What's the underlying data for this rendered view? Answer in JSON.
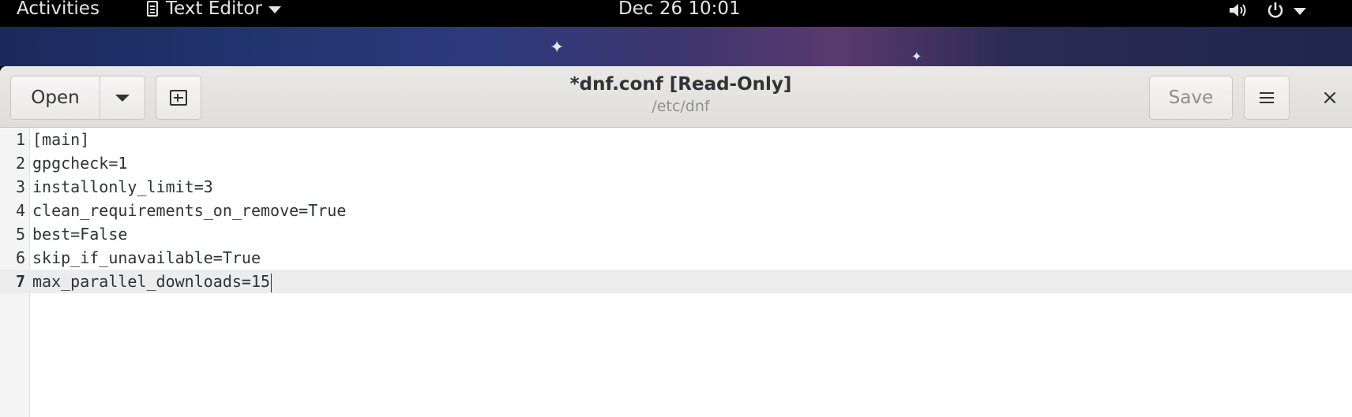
{
  "topbar": {
    "activities_label": "Activities",
    "app_name": "Text Editor",
    "clock": "Dec 26  10:01",
    "icons": [
      "text-editor-icon",
      "volume-icon",
      "power-icon",
      "chevron-down-icon"
    ]
  },
  "window": {
    "title": "*dnf.conf [Read-Only]",
    "subtitle": "/etc/dnf",
    "open_label": "Open",
    "save_label": "Save",
    "close_glyph": "×"
  },
  "editor": {
    "current_line": 7,
    "lines": [
      {
        "num": "1",
        "text": "[main]"
      },
      {
        "num": "2",
        "text": "gpgcheck=1"
      },
      {
        "num": "3",
        "text": "installonly_limit=3"
      },
      {
        "num": "4",
        "text": "clean_requirements_on_remove=True"
      },
      {
        "num": "5",
        "text": "best=False"
      },
      {
        "num": "6",
        "text": "skip_if_unavailable=True"
      },
      {
        "num": "7",
        "text": "max_parallel_downloads=15"
      }
    ]
  },
  "colors": {
    "topbar_bg": "#000000",
    "headerbar_bg": "#e8e6e3",
    "current_line_bg": "#ececec",
    "text": "#2e3436",
    "disabled_text": "#8b8e8f"
  }
}
